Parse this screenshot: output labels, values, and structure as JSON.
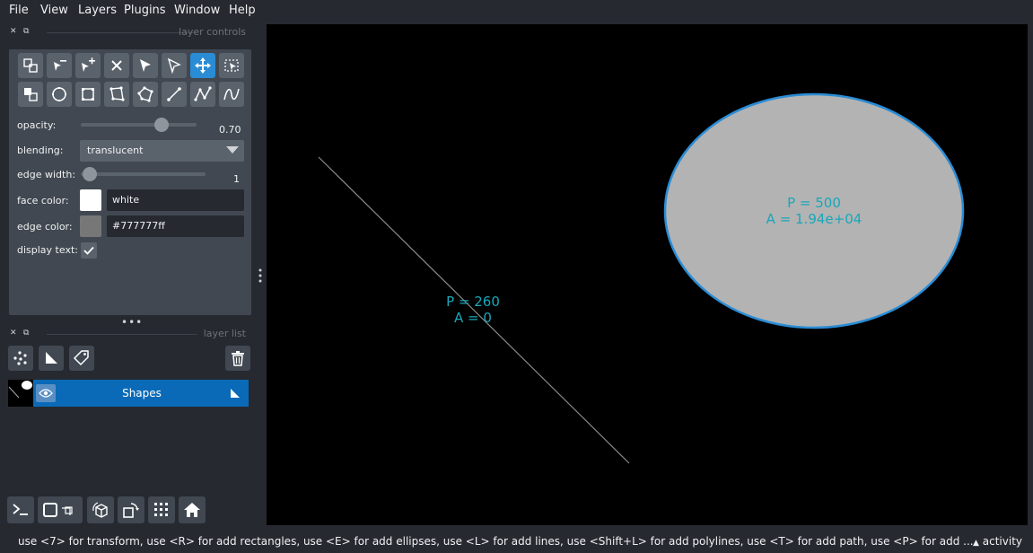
{
  "menu": [
    "File",
    "View",
    "Layers",
    "Plugins",
    "Window",
    "Help"
  ],
  "layer_controls": {
    "title": "layer controls",
    "opacity_label": "opacity:",
    "opacity_value": "0.70",
    "opacity": 0.7,
    "blending_label": "blending:",
    "blending_value": "translucent",
    "edge_width_label": "edge width:",
    "edge_width_value": "1",
    "face_color_label": "face color:",
    "face_color_value": "white",
    "face_color": "#ffffff",
    "edge_color_label": "edge color:",
    "edge_color_value": "#777777ff",
    "edge_color": "#777777",
    "display_text_label": "display text:",
    "display_text_checked": true
  },
  "layer_list": {
    "title": "layer list",
    "layers": [
      {
        "name": "Shapes",
        "selected": true,
        "visible": true
      }
    ]
  },
  "canvas": {
    "line_label_p": "P = 260",
    "line_label_a": "A = 0",
    "ellipse_label_p": "P = 500",
    "ellipse_label_a": "A = 1.94e+04",
    "ellipse_fill": "#b3b3b3",
    "ellipse_edge": "#2a8cd5",
    "text_color": "#19a7b9"
  },
  "status": {
    "message": "use <7> for transform, use <R> for add rectangles, use <E> for add ellipses, use <L> for add lines, use <Shift+L> for add polylines, use <T> for add path, use <P> for add ...",
    "activity": "activity"
  },
  "colors": {
    "accent": "#2a8cd5",
    "background": "#262930",
    "panel": "#414851"
  }
}
